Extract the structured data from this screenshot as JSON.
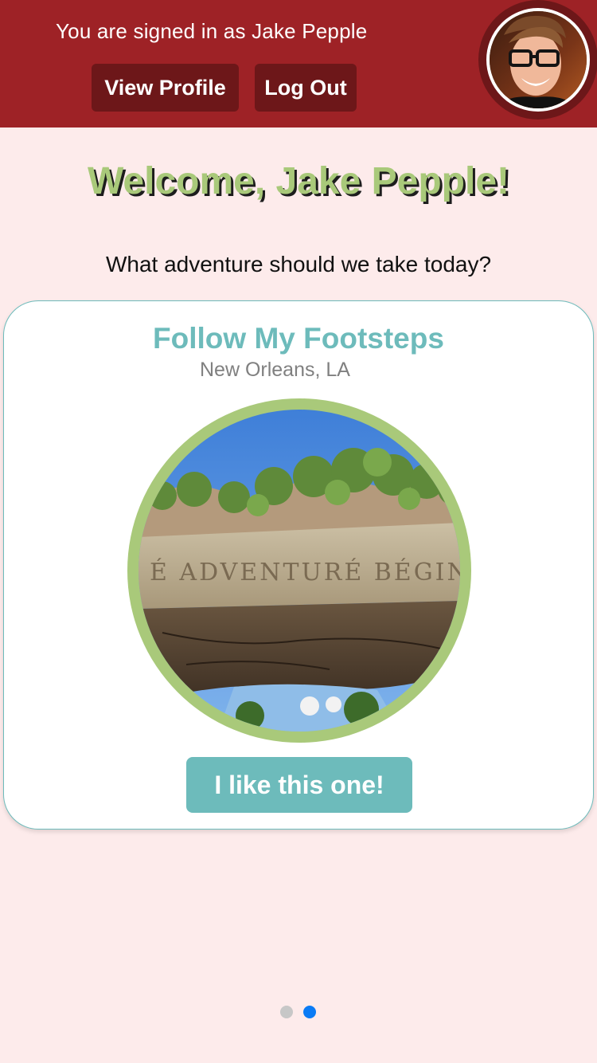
{
  "header": {
    "signed_in_text": "You are signed in as Jake Pepple",
    "view_profile_label": "View Profile",
    "log_out_label": "Log Out",
    "avatar_icon": "user-avatar-photo"
  },
  "main": {
    "welcome_title": "Welcome, Jake Pepple!",
    "prompt": "What adventure should we take today?"
  },
  "card": {
    "title": "Follow My Footsteps",
    "location": "New Orleans, LA",
    "photo_sign_text": "É ADVENTURÉ BÉGIN",
    "like_button_label": "I like this one!"
  },
  "pagination": {
    "total_pages": 2,
    "active_page": 2
  },
  "colors": {
    "header_bg": "#9e2226",
    "header_button_bg": "#6d1719",
    "page_bg": "#fdebeb",
    "welcome_green": "#a9c97a",
    "teal_accent": "#6dbbbb",
    "active_dot": "#0a7bf5",
    "inactive_dot": "#c7c7c7"
  }
}
